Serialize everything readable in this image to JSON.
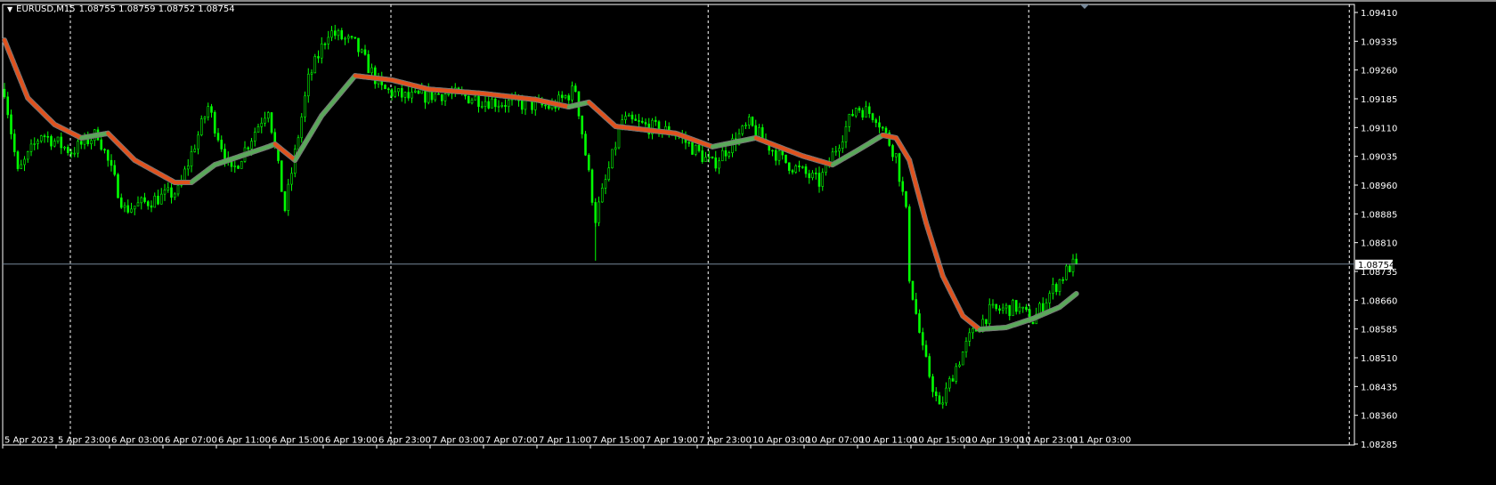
{
  "header": {
    "symbol": "EURUSD,M15",
    "ohlc": "1.08755 1.08759 1.08752 1.08754"
  },
  "colors": {
    "bull": "#00ff00",
    "ma_up": "#5aa85a",
    "ma_down": "#e0521e",
    "grid": "#ffffff",
    "price_line": "#778899"
  },
  "chart_data": {
    "type": "candlestick",
    "symbol": "EURUSD",
    "timeframe": "M15",
    "ylim": [
      1.08285,
      1.0941
    ],
    "y_ticks": [
      "1.09410",
      "1.09335",
      "1.09260",
      "1.09185",
      "1.09110",
      "1.09035",
      "1.08960",
      "1.08885",
      "1.08810",
      "1.08735",
      "1.08660",
      "1.08585",
      "1.08510",
      "1.08435",
      "1.08360",
      "1.08285"
    ],
    "current_price": "1.08754",
    "x_labels": [
      "5 Apr 2023",
      "5 Apr 23:00",
      "6 Apr 03:00",
      "6 Apr 07:00",
      "6 Apr 11:00",
      "6 Apr 15:00",
      "6 Apr 19:00",
      "6 Apr 23:00",
      "7 Apr 03:00",
      "7 Apr 07:00",
      "7 Apr 11:00",
      "7 Apr 15:00",
      "7 Apr 19:00",
      "7 Apr 23:00",
      "10 Apr 03:00",
      "10 Apr 07:00",
      "10 Apr 11:00",
      "10 Apr 15:00",
      "10 Apr 19:00",
      "10 Apr 23:00",
      "11 Apr 03:00"
    ],
    "bars_per_label": 16,
    "day_separator_bars": [
      20,
      116,
      211,
      307,
      403
    ],
    "price_path": [
      [
        0,
        1.0921
      ],
      [
        4,
        1.0899
      ],
      [
        11,
        1.09095
      ],
      [
        20,
        1.09048
      ],
      [
        28,
        1.09095
      ],
      [
        36,
        1.08897
      ],
      [
        44,
        1.0892
      ],
      [
        52,
        1.08944
      ],
      [
        61,
        1.09164
      ],
      [
        68,
        1.0899
      ],
      [
        79,
        1.09164
      ],
      [
        84,
        1.08897
      ],
      [
        91,
        1.09234
      ],
      [
        97,
        1.09361
      ],
      [
        105,
        1.09326
      ],
      [
        113,
        1.0921
      ],
      [
        121,
        1.09187
      ],
      [
        132,
        1.09199
      ],
      [
        148,
        1.09176
      ],
      [
        164,
        1.09164
      ],
      [
        171,
        1.0921
      ],
      [
        177,
        1.08874
      ],
      [
        185,
        1.09129
      ],
      [
        201,
        1.09095
      ],
      [
        212,
        1.09013
      ],
      [
        223,
        1.09118
      ],
      [
        233,
        1.09025
      ],
      [
        244,
        1.08967
      ],
      [
        255,
        1.09164
      ],
      [
        261,
        1.09141
      ],
      [
        267,
        1.09036
      ],
      [
        270,
        1.08886
      ],
      [
        271,
        1.08723
      ],
      [
        275,
        1.08526
      ],
      [
        280,
        1.08375
      ],
      [
        284,
        1.08468
      ],
      [
        289,
        1.08561
      ],
      [
        295,
        1.0863
      ],
      [
        303,
        1.08642
      ],
      [
        308,
        1.08607
      ],
      [
        313,
        1.08677
      ],
      [
        319,
        1.08747
      ],
      [
        321,
        1.08754
      ]
    ],
    "spikes": [
      [
        177,
        1.08763
      ]
    ],
    "moving_average": [
      [
        0,
        1.09338
      ],
      [
        7,
        1.09187
      ],
      [
        15,
        1.09118
      ],
      [
        23,
        1.09083
      ],
      [
        31,
        1.09095
      ],
      [
        39,
        1.09025
      ],
      [
        51,
        1.08967
      ],
      [
        56,
        1.08967
      ],
      [
        63,
        1.09013
      ],
      [
        79,
        1.0906
      ],
      [
        81,
        1.09067
      ],
      [
        87,
        1.09025
      ],
      [
        95,
        1.09141
      ],
      [
        105,
        1.09245
      ],
      [
        116,
        1.09234
      ],
      [
        127,
        1.0921
      ],
      [
        143,
        1.09199
      ],
      [
        159,
        1.09183
      ],
      [
        169,
        1.09164
      ],
      [
        175,
        1.09176
      ],
      [
        183,
        1.09113
      ],
      [
        201,
        1.09095
      ],
      [
        212,
        1.0906
      ],
      [
        225,
        1.09083
      ],
      [
        239,
        1.09036
      ],
      [
        248,
        1.09013
      ],
      [
        255,
        1.09048
      ],
      [
        263,
        1.0909
      ],
      [
        267,
        1.09083
      ],
      [
        271,
        1.09025
      ],
      [
        276,
        1.08862
      ],
      [
        281,
        1.08723
      ],
      [
        287,
        1.08619
      ],
      [
        292,
        1.08584
      ],
      [
        300,
        1.08589
      ],
      [
        308,
        1.08612
      ],
      [
        316,
        1.08642
      ],
      [
        321,
        1.08677
      ]
    ]
  }
}
